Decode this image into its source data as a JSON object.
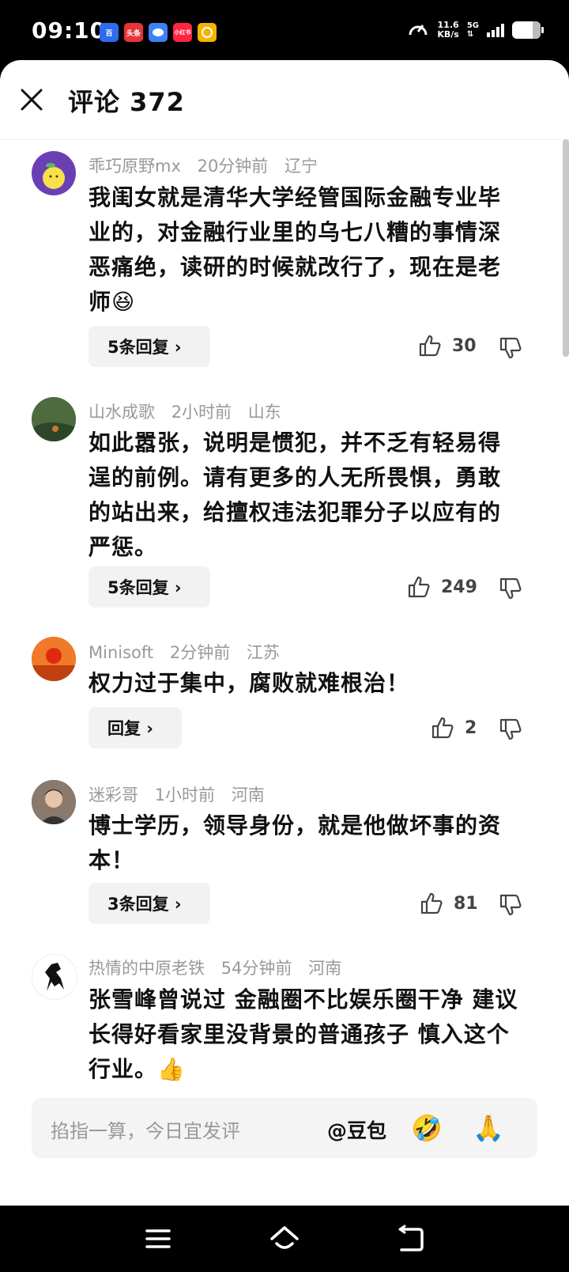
{
  "status_bar": {
    "time": "09:10",
    "speed_value": "11.6",
    "speed_unit": "KB/s",
    "network": "5G",
    "app_icons": [
      {
        "name": "baidu-app-icon",
        "color": "#2d6cf0",
        "label": "百"
      },
      {
        "name": "toutiao-app-icon",
        "color": "#e8333a",
        "label": "头条"
      },
      {
        "name": "message-app-icon",
        "color": "#3b82f6",
        "label": ""
      },
      {
        "name": "xiaohongshu-app-icon",
        "color": "#ff2442",
        "label": "小红书"
      },
      {
        "name": "wallet-app-icon",
        "color": "#f5b400",
        "label": ""
      }
    ]
  },
  "header": {
    "title": "评论 372"
  },
  "comments": [
    {
      "user": "乖巧原野mx",
      "time": "20分钟前",
      "location": "辽宁",
      "text": "我闺女就是清华大学经管国际金融专业毕业的，对金融行业里的乌七八糟的事情深恶痛绝，读研的时候就改行了，现在是老师",
      "emoji": "😆",
      "reply_label": "5条回复 ›",
      "likes": "30",
      "avatar_color": "#6a3fb5"
    },
    {
      "user": "山水成歌",
      "time": "2小时前",
      "location": "山东",
      "text": "如此嚣张，说明是惯犯，并不乏有轻易得逞的前例。请有更多的人无所畏惧，勇敢的站出来，给擅权违法犯罪分子以应有的严惩。",
      "reply_label": "5条回复 ›",
      "likes": "249",
      "avatar_color": "#3f5a3a"
    },
    {
      "user": "Minisoft",
      "time": "2分钟前",
      "location": "江苏",
      "text": "权力过于集中，腐败就难根治！",
      "reply_label": "回复 ›",
      "likes": "2",
      "avatar_color": "#e05a1a"
    },
    {
      "user": "迷彩哥",
      "time": "1小时前",
      "location": "河南",
      "text": "博士学历，领导身份，就是他做坏事的资本！",
      "reply_label": "3条回复 ›",
      "likes": "81",
      "avatar_color": "#5a4a40"
    },
    {
      "user": "热情的中原老铁",
      "time": "54分钟前",
      "location": "河南",
      "text": "张雪峰曾说过 金融圈不比娱乐圈干净 建议长得好看家里没背景的普通孩子 慎入这个行业。",
      "emoji": "👍",
      "avatar_color": "#ffffff"
    }
  ],
  "input": {
    "placeholder": "掐指一算，今日宜发评",
    "at_label": "@豆包",
    "emoji_1": "🤣",
    "emoji_2": "🙏"
  },
  "nav_icons": [
    "menu-icon",
    "home-icon",
    "back-icon"
  ]
}
